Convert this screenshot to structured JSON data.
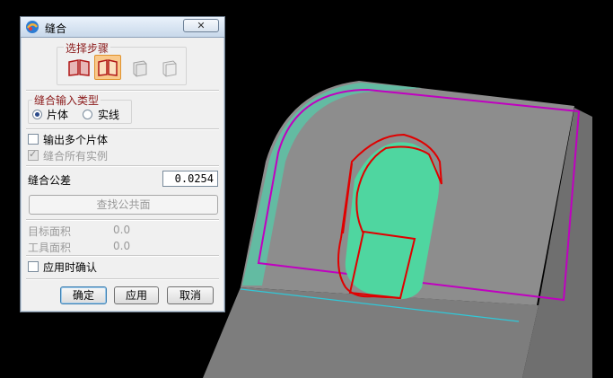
{
  "dialog": {
    "title": "缝合",
    "close_label": "✕",
    "steps_group_label": "选择步骤",
    "steps": [
      {
        "icon": "target-sheet-icon",
        "active": false
      },
      {
        "icon": "tool-sheet-icon",
        "active": true
      },
      {
        "icon": "target-body-icon",
        "active": false
      },
      {
        "icon": "tool-body-icon",
        "active": false
      }
    ],
    "input_type_group_label": "缝合输入类型",
    "input_type_options": [
      "片体",
      "实线"
    ],
    "input_type_selected": "片体",
    "output_multiple_label": "输出多个片体",
    "sew_all_instances_label": "缝合所有实例",
    "tolerance_label": "缝合公差",
    "tolerance_value": "0.0254",
    "find_common_faces_label": "查找公共面",
    "target_area_label": "目标面积",
    "target_area_value": "0.0",
    "tool_area_label": "工具面积",
    "tool_area_value": "0.0",
    "confirm_on_apply_label": "应用时确认",
    "ok_label": "确定",
    "apply_label": "应用",
    "cancel_label": "取消"
  },
  "colors": {
    "background": "#000000",
    "dialog_bg": "#f0f0f0",
    "label_red": "#8b1a1a",
    "active_step": "#f9c98b",
    "model_gray": "#8a8a8a",
    "sheet_green": "#4fd6a0",
    "curve_red": "#e00000",
    "boundary_magenta": "#c000c0",
    "edge_cyan": "#30c8d8"
  }
}
